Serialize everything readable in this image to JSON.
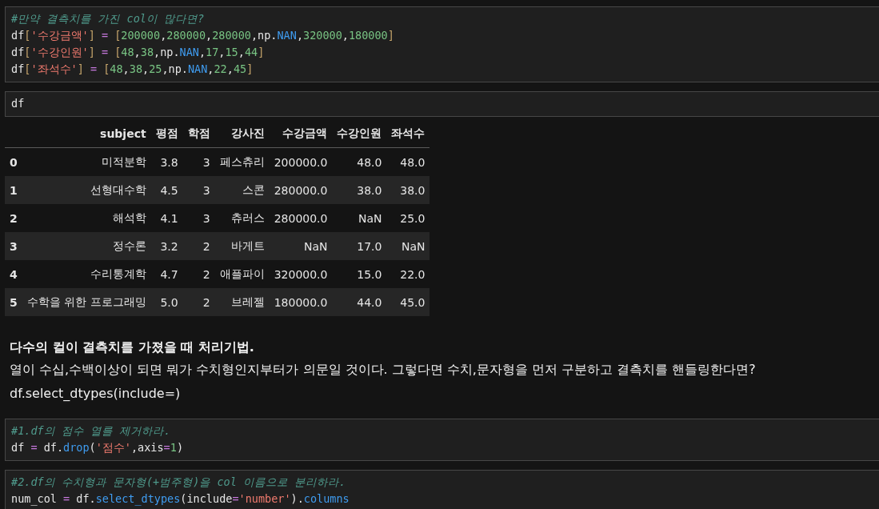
{
  "cells": [
    {
      "kind": "code",
      "lines": [
        [
          {
            "kind": "comment",
            "text": "#만약 결측치를 가진 col이 많다면?"
          }
        ],
        [
          {
            "kind": "name",
            "text": "df"
          },
          {
            "kind": "bracket",
            "text": "["
          },
          {
            "kind": "string",
            "text": "'수강금액'"
          },
          {
            "kind": "bracket",
            "text": "]"
          },
          {
            "kind": "op",
            "text": " = "
          },
          {
            "kind": "bracket",
            "text": "["
          },
          {
            "kind": "number",
            "text": "200000"
          },
          {
            "kind": "name",
            "text": ","
          },
          {
            "kind": "number",
            "text": "280000"
          },
          {
            "kind": "name",
            "text": ","
          },
          {
            "kind": "number",
            "text": "280000"
          },
          {
            "kind": "name",
            "text": ",np."
          },
          {
            "kind": "attr",
            "text": "NAN"
          },
          {
            "kind": "name",
            "text": ","
          },
          {
            "kind": "number",
            "text": "320000"
          },
          {
            "kind": "name",
            "text": ","
          },
          {
            "kind": "number",
            "text": "180000"
          },
          {
            "kind": "bracket",
            "text": "]"
          }
        ],
        [
          {
            "kind": "name",
            "text": "df"
          },
          {
            "kind": "bracket",
            "text": "["
          },
          {
            "kind": "string",
            "text": "'수강인원'"
          },
          {
            "kind": "bracket",
            "text": "]"
          },
          {
            "kind": "op",
            "text": " = "
          },
          {
            "kind": "bracket",
            "text": "["
          },
          {
            "kind": "number",
            "text": "48"
          },
          {
            "kind": "name",
            "text": ","
          },
          {
            "kind": "number",
            "text": "38"
          },
          {
            "kind": "name",
            "text": ",np."
          },
          {
            "kind": "attr",
            "text": "NAN"
          },
          {
            "kind": "name",
            "text": ","
          },
          {
            "kind": "number",
            "text": "17"
          },
          {
            "kind": "name",
            "text": ","
          },
          {
            "kind": "number",
            "text": "15"
          },
          {
            "kind": "name",
            "text": ","
          },
          {
            "kind": "number",
            "text": "44"
          },
          {
            "kind": "bracket",
            "text": "]"
          }
        ],
        [
          {
            "kind": "name",
            "text": "df"
          },
          {
            "kind": "bracket",
            "text": "["
          },
          {
            "kind": "string",
            "text": "'좌석수'"
          },
          {
            "kind": "bracket",
            "text": "]"
          },
          {
            "kind": "op",
            "text": " = "
          },
          {
            "kind": "bracket",
            "text": "["
          },
          {
            "kind": "number",
            "text": "48"
          },
          {
            "kind": "name",
            "text": ","
          },
          {
            "kind": "number",
            "text": "38"
          },
          {
            "kind": "name",
            "text": ","
          },
          {
            "kind": "number",
            "text": "25"
          },
          {
            "kind": "name",
            "text": ",np."
          },
          {
            "kind": "attr",
            "text": "NAN"
          },
          {
            "kind": "name",
            "text": ","
          },
          {
            "kind": "number",
            "text": "22"
          },
          {
            "kind": "name",
            "text": ","
          },
          {
            "kind": "number",
            "text": "45"
          },
          {
            "kind": "bracket",
            "text": "]"
          }
        ]
      ]
    },
    {
      "kind": "code",
      "lines": [
        [
          {
            "kind": "name",
            "text": "df"
          }
        ]
      ],
      "output": {
        "columns": [
          "",
          "subject",
          "평점",
          "학점",
          "강사진",
          "수강금액",
          "수강인원",
          "좌석수"
        ],
        "rows": [
          [
            "0",
            "미적분학",
            "3.8",
            "3",
            "페스츄리",
            "200000.0",
            "48.0",
            "48.0"
          ],
          [
            "1",
            "선형대수학",
            "4.5",
            "3",
            "스콘",
            "280000.0",
            "38.0",
            "38.0"
          ],
          [
            "2",
            "해석학",
            "4.1",
            "3",
            "츄러스",
            "280000.0",
            "NaN",
            "25.0"
          ],
          [
            "3",
            "정수론",
            "3.2",
            "2",
            "바게트",
            "NaN",
            "17.0",
            "NaN"
          ],
          [
            "4",
            "수리통계학",
            "4.7",
            "2",
            "애플파이",
            "320000.0",
            "15.0",
            "22.0"
          ],
          [
            "5",
            "수학을 위한 프로그래밍",
            "5.0",
            "2",
            "브레젤",
            "180000.0",
            "44.0",
            "45.0"
          ]
        ]
      }
    },
    {
      "kind": "markdown",
      "heading": "다수의 컬이 결측치를 가졌을 때 처리기법.",
      "paragraphs": [
        "열이 수십,수백이상이 되면 뭐가 수치형인지부터가 의문일 것이다. 그렇다면 수치,문자형을 먼저 구분하고 결측치를 핸들링한다면?",
        "df.select_dtypes(include=)"
      ]
    },
    {
      "kind": "code",
      "lines": [
        [
          {
            "kind": "comment",
            "text": "#1.df의 점수 열를 제거하라."
          }
        ],
        [
          {
            "kind": "name",
            "text": "df "
          },
          {
            "kind": "op",
            "text": "="
          },
          {
            "kind": "name",
            "text": " df."
          },
          {
            "kind": "attr",
            "text": "drop"
          },
          {
            "kind": "name",
            "text": "("
          },
          {
            "kind": "string",
            "text": "'점수'"
          },
          {
            "kind": "name",
            "text": ",axis"
          },
          {
            "kind": "op",
            "text": "="
          },
          {
            "kind": "number",
            "text": "1"
          },
          {
            "kind": "name",
            "text": ")"
          }
        ]
      ]
    },
    {
      "kind": "code",
      "lines": [
        [
          {
            "kind": "comment",
            "text": "#2.df의 수치형과 문자형(+범주형)을 col 이름으로 분리하라."
          }
        ],
        [
          {
            "kind": "name",
            "text": "num_col "
          },
          {
            "kind": "op",
            "text": "="
          },
          {
            "kind": "name",
            "text": " df."
          },
          {
            "kind": "attr",
            "text": "select_dtypes"
          },
          {
            "kind": "name",
            "text": "(include"
          },
          {
            "kind": "op",
            "text": "="
          },
          {
            "kind": "string",
            "text": "'number'"
          },
          {
            "kind": "name",
            "text": ")."
          },
          {
            "kind": "attr",
            "text": "columns"
          }
        ]
      ]
    }
  ]
}
